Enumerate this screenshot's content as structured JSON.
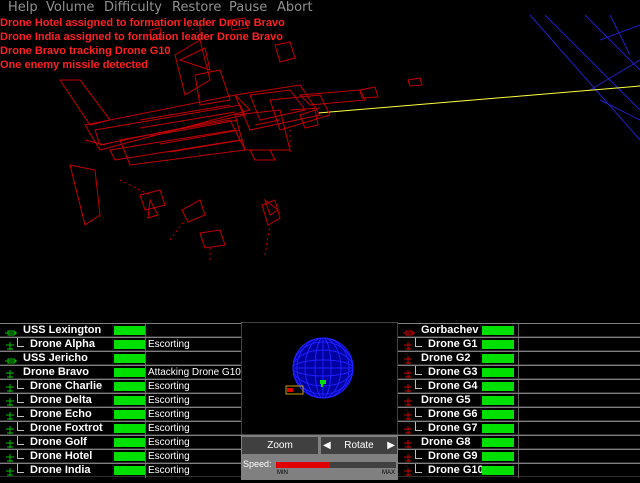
{
  "menu": [
    "Help",
    "Volume",
    "Difficulty",
    "Restore",
    "Pause",
    "Abort"
  ],
  "messages": [
    "Drone Hotel assigned to formation leader Drone Bravo",
    "Drone India assigned to formation leader Drone Bravo",
    "Drone Bravo tracking Drone G10",
    "One enemy missile detected"
  ],
  "colors": {
    "menu_text": "#909090",
    "message_text": "#ff2020",
    "health_bar": "#00e000",
    "speed_fill": "#e00000",
    "wireframe_enemy": "#c00000",
    "wireframe_blue": "#2020c0",
    "laser_beam": "#ffff40"
  },
  "left_units": [
    {
      "name": "USS Lexington",
      "status": "",
      "icon": "carrier-icon",
      "child": false
    },
    {
      "name": "Drone Alpha",
      "status": "Escorting",
      "icon": "fighter-icon",
      "child": true
    },
    {
      "name": "USS Jericho",
      "status": "",
      "icon": "carrier-icon",
      "child": false
    },
    {
      "name": "Drone Bravo",
      "status": "Attacking Drone G10",
      "icon": "fighter-icon",
      "child": false
    },
    {
      "name": "Drone Charlie",
      "status": "Escorting",
      "icon": "fighter-icon",
      "child": true
    },
    {
      "name": "Drone Delta",
      "status": "Escorting",
      "icon": "fighter-icon",
      "child": true
    },
    {
      "name": "Drone Echo",
      "status": "Escorting",
      "icon": "fighter-icon",
      "child": true
    },
    {
      "name": "Drone Foxtrot",
      "status": "Escorting",
      "icon": "fighter-icon",
      "child": true
    },
    {
      "name": "Drone Golf",
      "status": "Escorting",
      "icon": "fighter-icon",
      "child": true
    },
    {
      "name": "Drone Hotel",
      "status": "Escorting",
      "icon": "fighter-icon",
      "child": true
    },
    {
      "name": "Drone India",
      "status": "Escorting",
      "icon": "fighter-icon",
      "child": true
    }
  ],
  "right_units": [
    {
      "name": "Gorbachev",
      "icon": "enemy-carrier-icon",
      "child": false
    },
    {
      "name": "Drone G1",
      "icon": "enemy-fighter-icon",
      "child": true
    },
    {
      "name": "Drone G2",
      "icon": "enemy-fighter-icon",
      "child": false
    },
    {
      "name": "Drone G3",
      "icon": "enemy-fighter-icon",
      "child": true
    },
    {
      "name": "Drone G4",
      "icon": "enemy-fighter-icon",
      "child": true
    },
    {
      "name": "Drone G5",
      "icon": "enemy-fighter-icon",
      "child": false
    },
    {
      "name": "Drone G6",
      "icon": "enemy-fighter-icon",
      "child": true
    },
    {
      "name": "Drone G7",
      "icon": "enemy-fighter-icon",
      "child": true
    },
    {
      "name": "Drone G8",
      "icon": "enemy-fighter-icon",
      "child": false
    },
    {
      "name": "Drone G9",
      "icon": "enemy-fighter-icon",
      "child": true
    },
    {
      "name": "Drone G10",
      "icon": "enemy-fighter-icon",
      "child": true
    }
  ],
  "controls": {
    "zoom_label": "Zoom",
    "rotate_label": "Rotate",
    "speed_label": "Speed:",
    "speed_min": "MIN",
    "speed_max": "MAX",
    "speed_level": 0.45
  }
}
